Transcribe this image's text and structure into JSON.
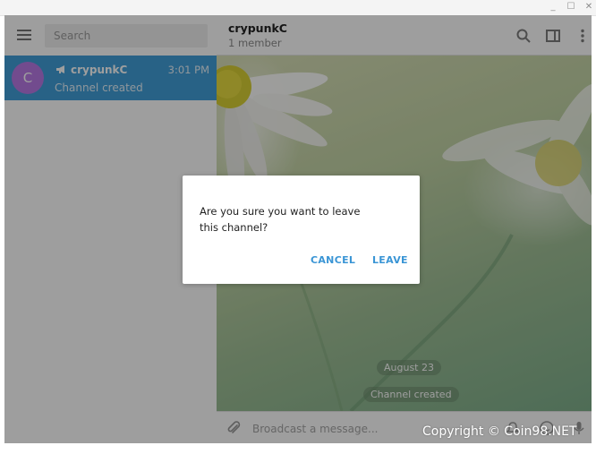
{
  "window": {
    "minimize_glyph": "_",
    "maximize_glyph": "☐",
    "close_glyph": "✕"
  },
  "sidebar": {
    "search_placeholder": "Search",
    "chats": [
      {
        "avatar_letter": "C",
        "name": "crypunkC",
        "time": "3:01 PM",
        "preview": "Channel created",
        "selected": true,
        "icon": "megaphone-icon"
      }
    ]
  },
  "chat": {
    "title": "crypunkC",
    "subtitle": "1 member",
    "header_icons": [
      "search-icon",
      "columns-icon",
      "more-vertical-icon"
    ],
    "service_messages": [
      "August 23",
      "Channel created"
    ],
    "composer_placeholder": "Broadcast a message...",
    "composer_icons": [
      "paperclip-icon",
      "silent-bell-icon",
      "emoji-icon",
      "mic-icon"
    ]
  },
  "dialog": {
    "message": "Are you sure you want to leave this channel?",
    "cancel_label": "CANCEL",
    "leave_label": "LEAVE"
  },
  "colors": {
    "accent": "#419fd9",
    "avatar": "#b87ae6",
    "dialog_button": "#3a95d5"
  },
  "watermark": "Copyright © Coin98.NET"
}
